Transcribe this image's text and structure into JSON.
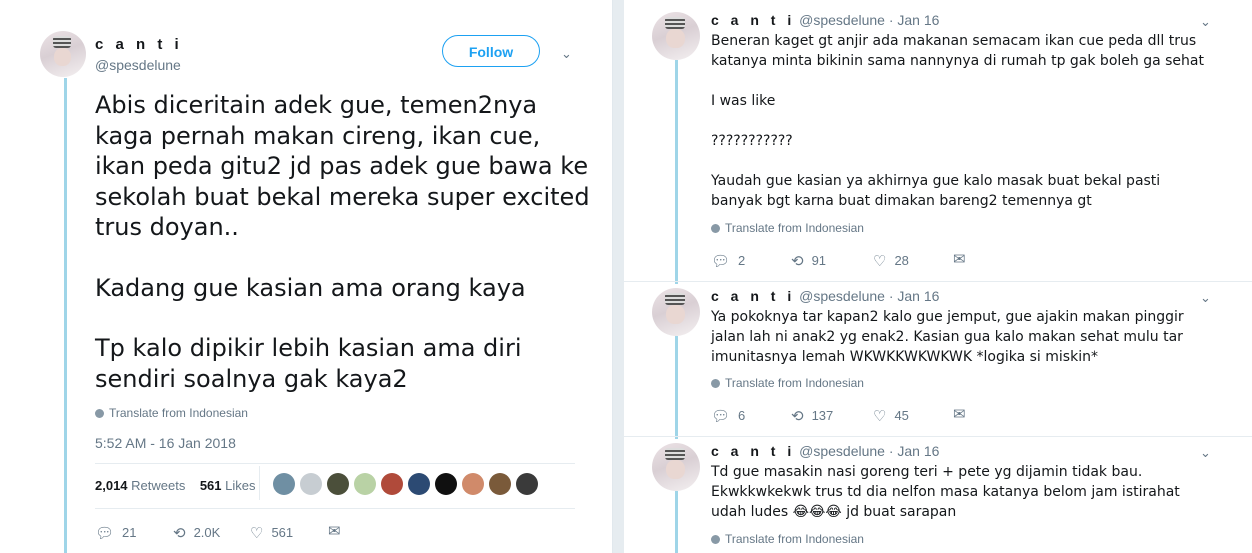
{
  "main_tweet": {
    "name": "c a n t i",
    "handle": "@spesdelune",
    "follow_label": "Follow",
    "paragraphs": [
      "Abis diceritain adek gue, temen2nya kaga pernah makan cireng, ikan cue, ikan peda gitu2 jd pas adek gue bawa ke sekolah buat bekal mereka super excited trus doyan..",
      "Kadang gue kasian ama orang kaya",
      "Tp kalo dipikir lebih kasian ama diri sendiri soalnya gak kaya2"
    ],
    "translate": "Translate from Indonesian",
    "timestamp": "5:52 AM - 16 Jan 2018",
    "retweets_count": "2,014",
    "retweets_label": "Retweets",
    "likes_count": "561",
    "likes_label": "Likes",
    "liker_colors": [
      "#6f8fa3",
      "#c7cdd2",
      "#4b4f3a",
      "#b9d2a5",
      "#b04a3a",
      "#2c4a73",
      "#101010",
      "#d08a6a",
      "#7a5a3a",
      "#3a3a3a"
    ],
    "actions": {
      "replies": "21",
      "retweets": "2.0K",
      "likes": "561"
    }
  },
  "replies": [
    {
      "name": "c a n t i",
      "handle": "@spesdelune",
      "date": "· Jan 16",
      "paragraphs": [
        "Beneran kaget gt anjir ada makanan semacam ikan cue peda dll trus katanya minta bikinin sama nannynya di rumah tp gak boleh ga sehat",
        "I was like",
        "???????????",
        "Yaudah gue kasian ya akhirnya gue kalo masak buat bekal pasti banyak bgt karna buat dimakan bareng2 temennya gt"
      ],
      "translate": "Translate from Indonesian",
      "actions": {
        "replies": "2",
        "retweets": "91",
        "likes": "28"
      }
    },
    {
      "name": "c a n t i",
      "handle": "@spesdelune",
      "date": "· Jan 16",
      "paragraphs": [
        "Ya pokoknya tar kapan2 kalo gue jemput, gue ajakin makan pinggir jalan lah ni anak2 yg enak2. Kasian gua kalo makan sehat mulu tar imunitasnya lemah WKWKKWKWKWK *logika si miskin*"
      ],
      "translate": "Translate from Indonesian",
      "actions": {
        "replies": "6",
        "retweets": "137",
        "likes": "45"
      }
    },
    {
      "name": "c a n t i",
      "handle": "@spesdelune",
      "date": "· Jan 16",
      "paragraphs": [
        "Td gue masakin nasi goreng teri + pete yg dijamin tidak bau. Ekwkkwkekwk trus td dia nelfon masa katanya belom jam istirahat udah ludes 😂😂😂 jd buat sarapan"
      ],
      "translate": "Translate from Indonesian"
    }
  ],
  "icons": {
    "reply": "reply-icon",
    "retweet": "retweet-icon",
    "like": "heart-icon",
    "dm": "envelope-icon",
    "more": "chevron-down-icon",
    "globe": "globe-icon"
  },
  "colors": {
    "accent": "#1da1f2",
    "thread": "#9fd5e8",
    "muted": "#657786"
  }
}
